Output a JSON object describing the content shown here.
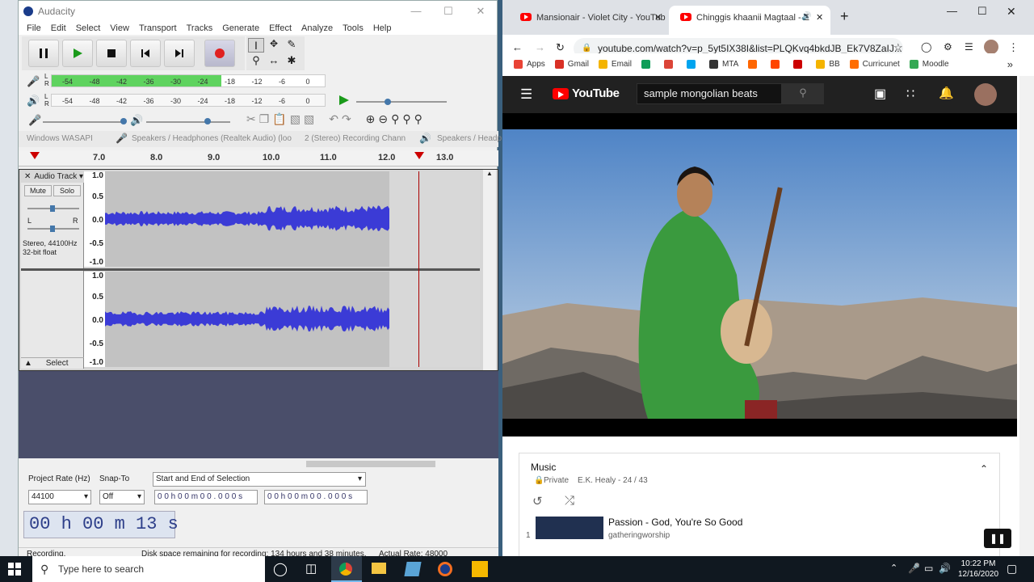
{
  "audacity": {
    "title": "Audacity",
    "menu": [
      "File",
      "Edit",
      "Select",
      "View",
      "Transport",
      "Tracks",
      "Generate",
      "Effect",
      "Analyze",
      "Tools",
      "Help"
    ],
    "rec_meter_ticks": [
      "-54",
      "-48",
      "-42",
      "-36",
      "-30",
      "-24",
      "-18",
      "-12",
      "-6",
      "0"
    ],
    "play_meter_ticks": [
      "-54",
      "-48",
      "-42",
      "-36",
      "-30",
      "-24",
      "-18",
      "-12",
      "-6",
      "0"
    ],
    "rec_level": 0.62,
    "host": "Windows WASAPI",
    "output_device": "Speakers / Headphones (Realtek Audio) (loo",
    "rec_channels": "2 (Stereo) Recording Chann",
    "playback_device": "Speakers / Headp",
    "ruler": [
      "7.0",
      "8.0",
      "9.0",
      "10.0",
      "11.0",
      "12.0",
      "13.0"
    ],
    "track_name": "Audio Track",
    "mute": "Mute",
    "solo": "Solo",
    "pan_l": "L",
    "pan_r": "R",
    "track_info_1": "Stereo, 44100Hz",
    "track_info_2": "32-bit float",
    "select_btn": "Select",
    "axis": [
      "1.0",
      "0.5",
      "0.0",
      "-0.5",
      "-1.0"
    ],
    "project_rate_label": "Project Rate (Hz)",
    "snap_label": "Snap-To",
    "selection_mode": "Start and End of Selection",
    "project_rate": "44100",
    "snap": "Off",
    "sel_start": "0 0 h 0 0 m 0 0 . 0 0 0 s",
    "sel_end": "0 0 h 0 0 m 0 0 . 0 0 0 s",
    "time": "00 h 00 m 13 s",
    "status": "Recording.",
    "disk": "Disk space remaining for recording: 134 hours and 38 minutes.",
    "rate": "Actual Rate: 48000"
  },
  "chrome": {
    "tab1": "Mansionair - Violet City - YouTub",
    "tab2": "Chinggis khaanii Magtaal - E",
    "url": "youtube.com/watch?v=p_5yt5IX38I&list=PLQKvq4bkdJB_Ek7V8ZaIJ...",
    "bookmarks": [
      "Apps",
      "Gmail",
      "Email",
      "",
      "",
      "",
      "MTA",
      "",
      "",
      "",
      "BB",
      "Curricunet",
      "Moodle"
    ],
    "bookmark_colors": [
      "#e94335",
      "#d93025",
      "#f4b400",
      "#0f9d58",
      "#db4437",
      "#00a4ef",
      "#333333",
      "#ff6600",
      "#ff4500",
      "#cc0000",
      "#f4b400",
      "#ff6d00",
      "#34a853"
    ]
  },
  "youtube": {
    "logo": "YouTube",
    "search": "sample mongolian beats",
    "playlist_title": "Music",
    "privacy": "Private",
    "owner": "E.K. Healy - 24 / 43",
    "item_index": "1",
    "item_title": "Passion - God, You're So Good",
    "item_channel": "gatheringworship"
  },
  "taskbar": {
    "search": "Type here to search",
    "time": "10:22 PM",
    "date": "12/16/2020"
  }
}
